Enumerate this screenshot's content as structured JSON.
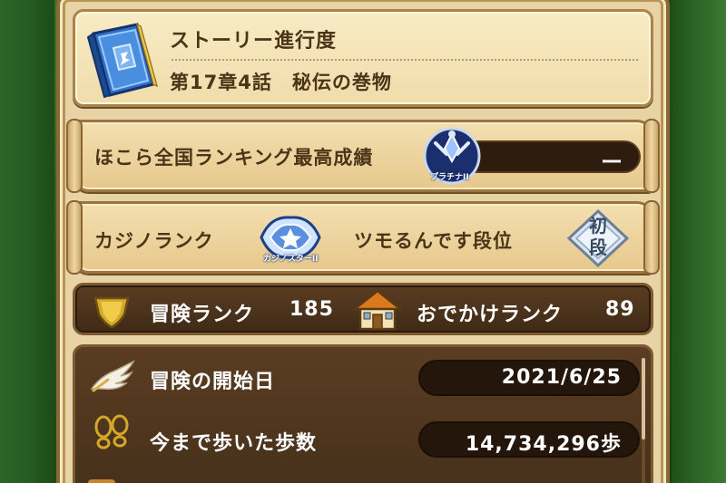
{
  "story": {
    "title": "ストーリー進行度",
    "progress": "第17章4話　秘伝の巻物"
  },
  "hokora_ranking": {
    "label": "ほこら全国ランキング最高成績",
    "badge_caption": "プラチナII",
    "value": "ー"
  },
  "casino": {
    "label": "カジノランク",
    "badge_caption": "カジノスターII"
  },
  "tsumo": {
    "label": "ツモるんです段位",
    "badge_text": "初段"
  },
  "ranks": {
    "adventure_label": "冒険ランク",
    "adventure_value": "185",
    "outing_label": "おでかけランク",
    "outing_value": "89"
  },
  "stats": [
    {
      "label": "冒険の開始日",
      "value": "2021/6/25",
      "icon": "wing-icon"
    },
    {
      "label": "今まで歩いた歩数",
      "value": "14,734,296歩",
      "icon": "footprints-icon"
    }
  ],
  "colors": {
    "parchment": "#f3dfb0",
    "dark_panel": "#45301a",
    "text_brown": "#4b3418",
    "pill": "#24160a"
  }
}
